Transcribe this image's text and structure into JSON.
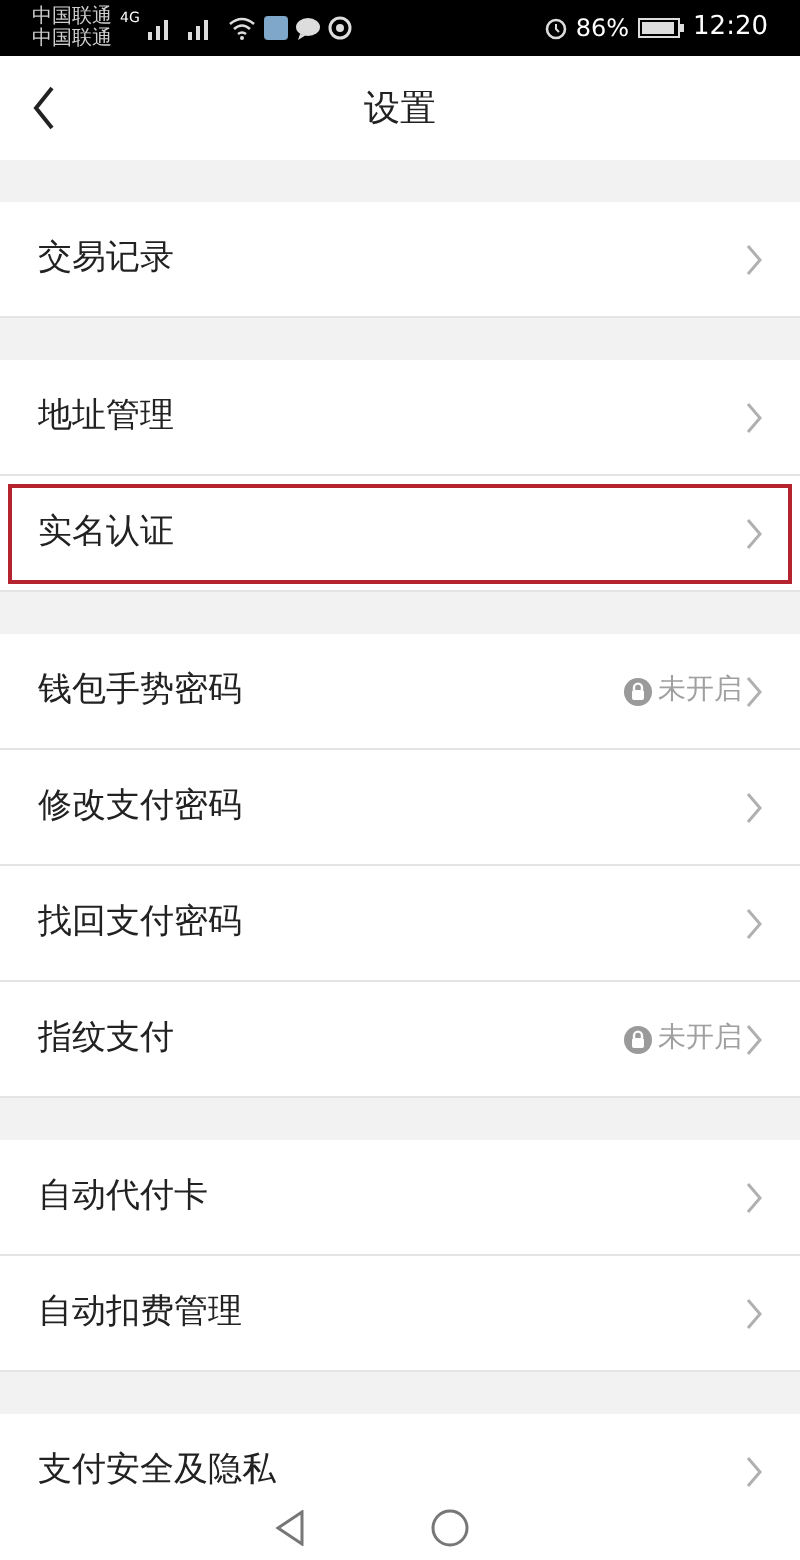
{
  "status_bar": {
    "carriers": [
      "中国联通",
      "中国联通"
    ],
    "network": "4G",
    "battery": "86%",
    "time": "12:20"
  },
  "header": {
    "title": "设置"
  },
  "sections": [
    {
      "items": [
        {
          "label": "交易记录",
          "highlighted": false
        }
      ]
    },
    {
      "items": [
        {
          "label": "地址管理",
          "highlighted": false
        },
        {
          "label": "实名认证",
          "highlighted": true
        }
      ]
    },
    {
      "items": [
        {
          "label": "钱包手势密码",
          "status": "未开启",
          "highlighted": false
        },
        {
          "label": "修改支付密码",
          "highlighted": false
        },
        {
          "label": "找回支付密码",
          "highlighted": false
        },
        {
          "label": "指纹支付",
          "status": "未开启",
          "highlighted": false
        }
      ]
    },
    {
      "items": [
        {
          "label": "自动代付卡",
          "highlighted": false
        },
        {
          "label": "自动扣费管理",
          "highlighted": false
        }
      ]
    },
    {
      "items": [
        {
          "label": "支付安全及隐私",
          "highlighted": false
        }
      ]
    }
  ]
}
